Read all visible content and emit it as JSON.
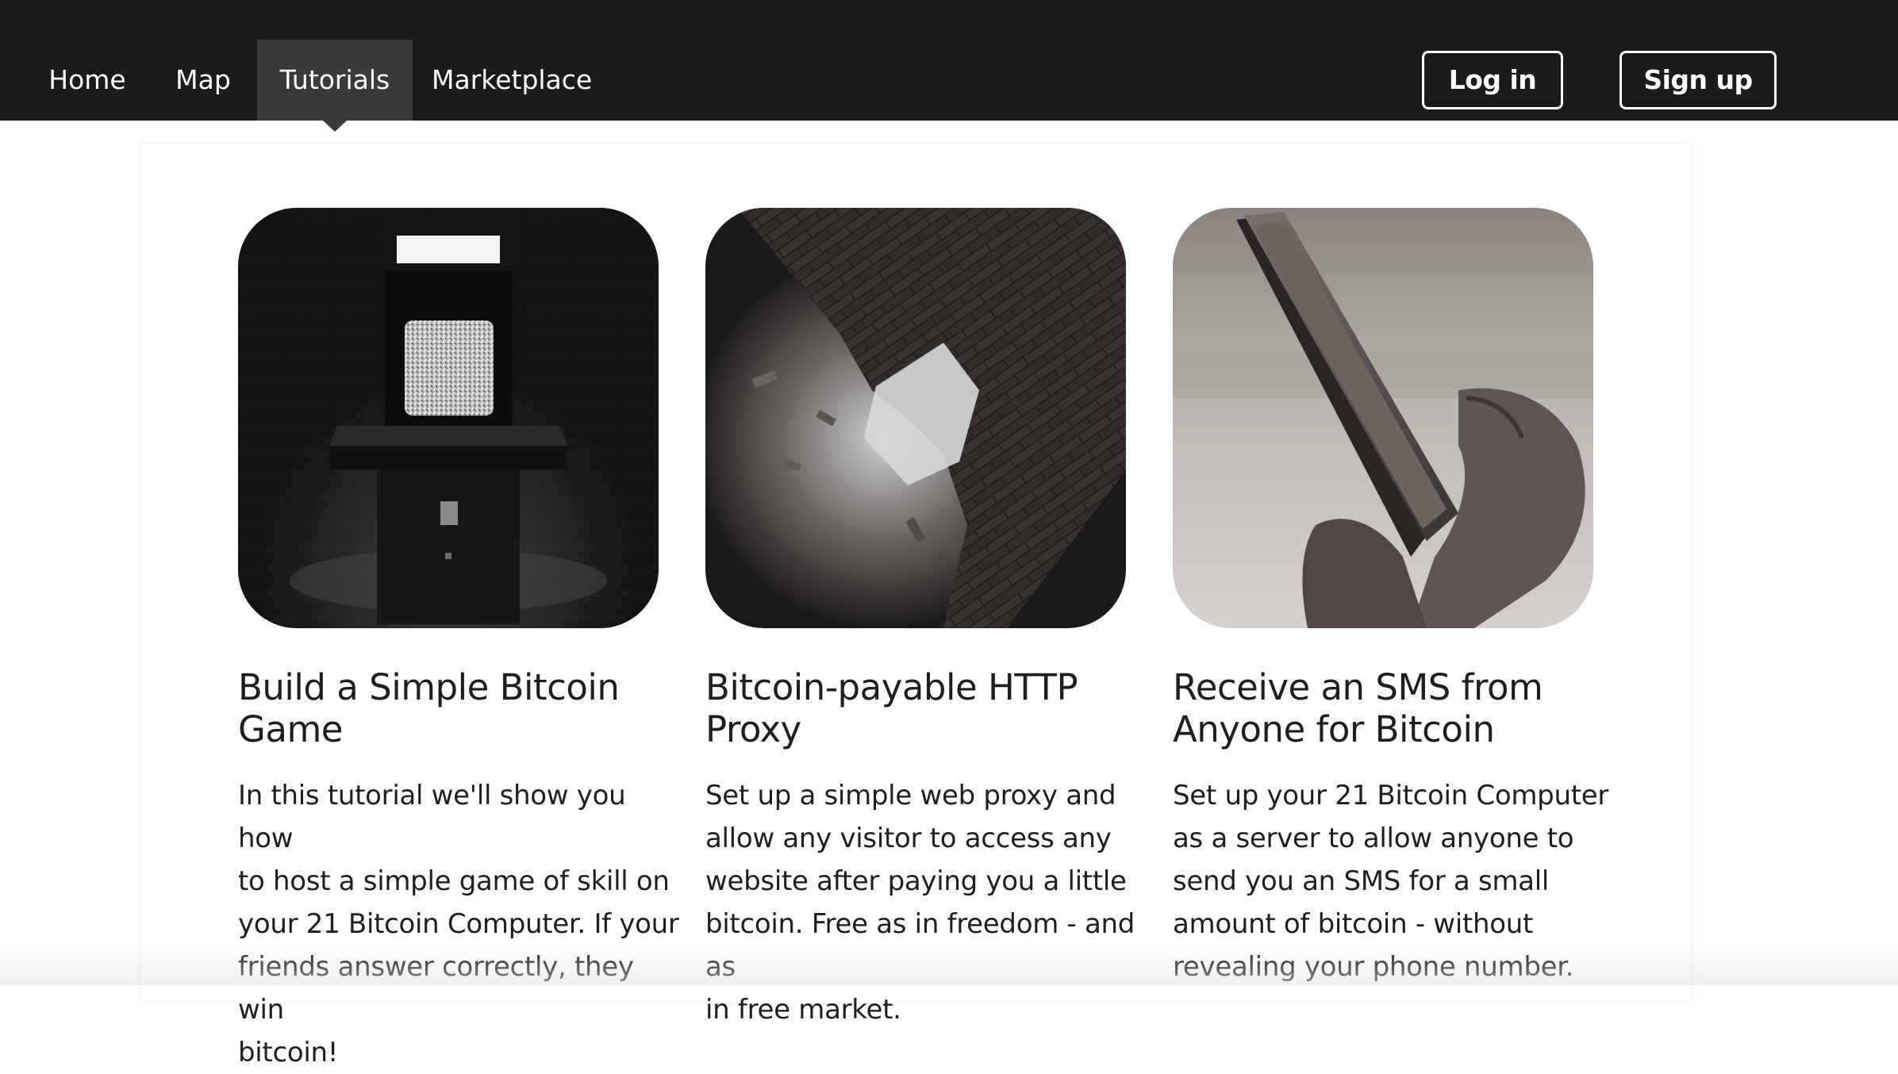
{
  "nav": {
    "items": [
      {
        "label": "Home",
        "active": false
      },
      {
        "label": "Map",
        "active": false
      },
      {
        "label": "Tutorials",
        "active": true
      },
      {
        "label": "Marketplace",
        "active": false
      }
    ],
    "login_label": "Log in",
    "signup_label": "Sign up"
  },
  "cards": [
    {
      "image": "arcade-machine-image",
      "title_line1": "Build a Simple Bitcoin",
      "title_line2": "Game",
      "desc_lines": [
        "In this tutorial we'll show you how",
        "to host a simple game of skill on",
        "your 21 Bitcoin Computer. If your",
        "friends answer correctly, they win",
        "bitcoin!"
      ]
    },
    {
      "image": "broken-brick-wall-image",
      "title_line1": "Bitcoin-payable HTTP",
      "title_line2": "Proxy",
      "desc_lines": [
        "Set up a simple web proxy and",
        "allow any visitor to access any",
        "website after paying you a little",
        "bitcoin. Free as in freedom - and as",
        "in free market."
      ]
    },
    {
      "image": "hands-holding-phone-image",
      "title_line1": "Receive an SMS from",
      "title_line2": "Anyone for Bitcoin",
      "desc_lines": [
        "Set up your 21 Bitcoin Computer",
        "as a server to allow anyone to",
        "send you an SMS for a small",
        "amount of bitcoin - without",
        "revealing your phone number."
      ]
    }
  ],
  "colors": {
    "navbar_bg": "#1b1b1b",
    "nav_active_bg": "#3a3a3c",
    "text": "#1e1e1e"
  }
}
